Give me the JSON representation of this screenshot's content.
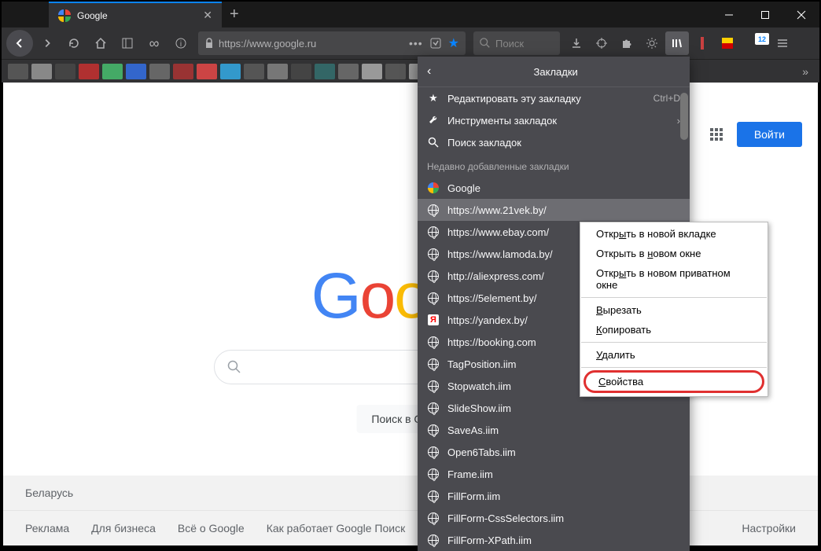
{
  "tab": {
    "title": "Google"
  },
  "url": "https://www.google.ru",
  "search_placeholder": "Поиск",
  "calendar_badge": "12",
  "bookmarks_panel": {
    "title": "Закладки",
    "edit": "Редактировать эту закладку",
    "edit_shortcut": "Ctrl+D",
    "tools": "Инструменты закладок",
    "search": "Поиск закладок",
    "recent_header": "Недавно добавленные закладки",
    "items": [
      {
        "label": "Google",
        "icon": "google"
      },
      {
        "label": "https://www.21vek.by/",
        "icon": "globe",
        "selected": true
      },
      {
        "label": "https://www.ebay.com/",
        "icon": "globe"
      },
      {
        "label": "https://www.lamoda.by/",
        "icon": "globe"
      },
      {
        "label": "http://aliexpress.com/",
        "icon": "globe"
      },
      {
        "label": "https://5element.by/",
        "icon": "globe"
      },
      {
        "label": "https://yandex.by/",
        "icon": "yandex"
      },
      {
        "label": "https://booking.com",
        "icon": "globe"
      },
      {
        "label": "TagPosition.iim",
        "icon": "globe"
      },
      {
        "label": "Stopwatch.iim",
        "icon": "globe"
      },
      {
        "label": "SlideShow.iim",
        "icon": "globe"
      },
      {
        "label": "SaveAs.iim",
        "icon": "globe"
      },
      {
        "label": "Open6Tabs.iim",
        "icon": "globe"
      },
      {
        "label": "Frame.iim",
        "icon": "globe"
      },
      {
        "label": "FillForm.iim",
        "icon": "globe"
      },
      {
        "label": "FillForm-CssSelectors.iim",
        "icon": "globe"
      },
      {
        "label": "FillForm-XPath.iim",
        "icon": "globe"
      }
    ]
  },
  "context_menu": {
    "open_tab": "Открыть в новой вкладке",
    "open_window": "Открыть в новом окне",
    "open_private": "Открыть в новом приватном окне",
    "cut": "Вырезать",
    "copy": "Копировать",
    "delete": "Удалить",
    "properties": "Свойства"
  },
  "google": {
    "signin": "Войти",
    "search_button": "Поиск в Google",
    "country": "Беларусь",
    "footer_left": [
      "Реклама",
      "Для бизнеса",
      "Всё о Google",
      "Как работает Google Поиск"
    ],
    "footer_right": "Настройки"
  }
}
